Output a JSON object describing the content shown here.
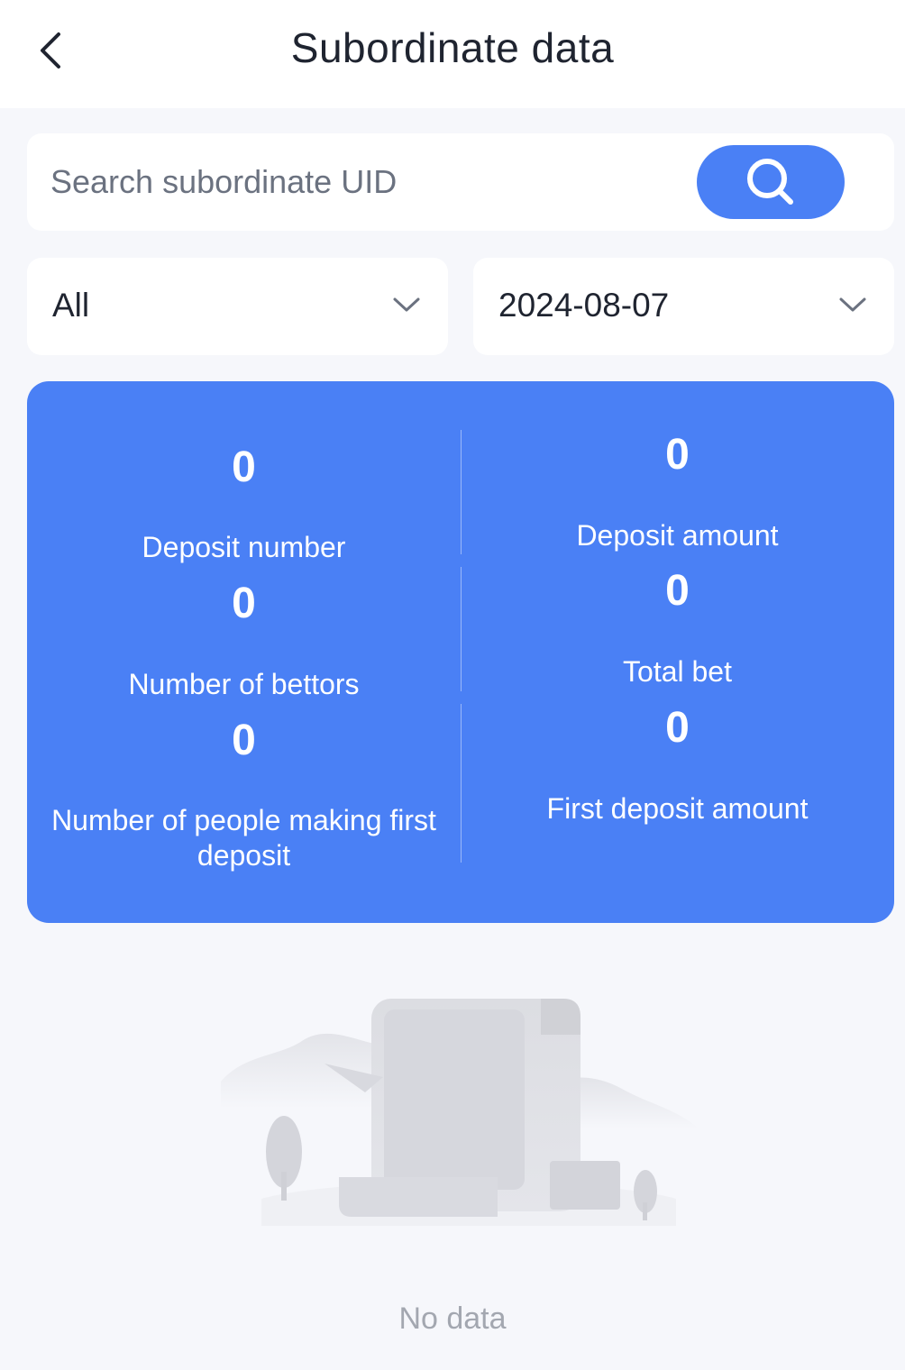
{
  "header": {
    "title": "Subordinate data",
    "back_icon": "chevron-left-icon"
  },
  "search": {
    "placeholder": "Search subordinate UID",
    "value": "",
    "button_icon": "search-icon",
    "button_color": "#4a80f5"
  },
  "filters": {
    "level": {
      "selected": "All",
      "icon": "chevron-down-icon"
    },
    "date": {
      "selected": "2024-08-07",
      "icon": "chevron-down-icon"
    }
  },
  "stats": {
    "background": "#4a80f5",
    "items": [
      {
        "value": "0",
        "label": "Deposit number"
      },
      {
        "value": "0",
        "label": "Deposit amount"
      },
      {
        "value": "0",
        "label": "Number of bettors"
      },
      {
        "value": "0",
        "label": "Total bet"
      },
      {
        "value": "0",
        "label": "Number of people making first deposit"
      },
      {
        "value": "0",
        "label": "First deposit amount"
      }
    ]
  },
  "empty_state": {
    "illustration": "empty-document-icon",
    "text": "No data"
  }
}
